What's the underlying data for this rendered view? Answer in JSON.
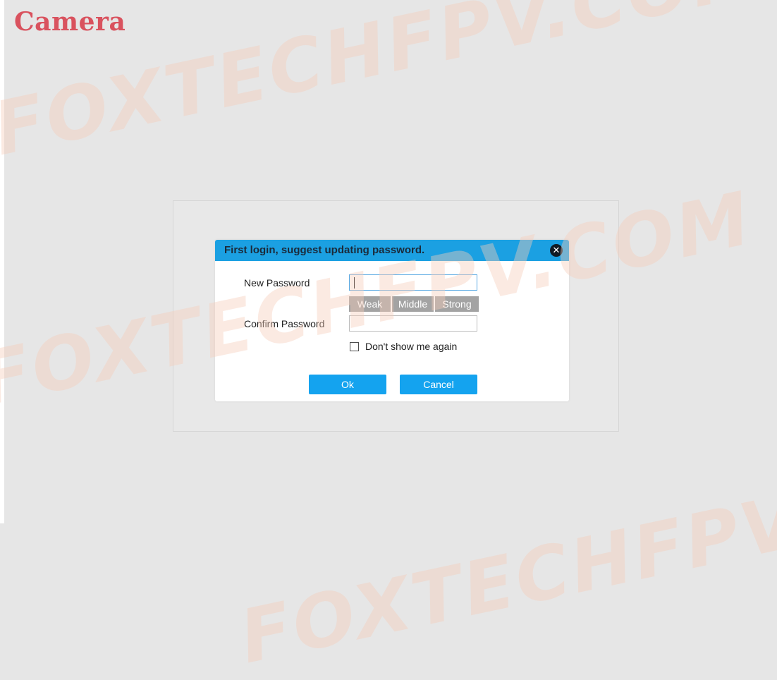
{
  "header": {
    "logo_text": "Camera"
  },
  "watermark": {
    "text": "FOXTECHFPV.COM"
  },
  "dialog": {
    "title": "First login, suggest updating password.",
    "close_icon": "close-icon",
    "new_password": {
      "label": "New Password",
      "value": "",
      "placeholder": ""
    },
    "strength": {
      "weak": "Weak",
      "middle": "Middle",
      "strong": "Strong"
    },
    "confirm_password": {
      "label": "Confirm Password",
      "value": "",
      "placeholder": ""
    },
    "dont_show": {
      "label": "Don't show me again",
      "checked": false
    },
    "ok_label": "Ok",
    "cancel_label": "Cancel"
  },
  "colors": {
    "accent": "#1ba0e2",
    "button": "#14a3ef",
    "strength_bar": "#a3a3a3",
    "logo": "#d9525e",
    "background": "#e6e6e6"
  }
}
